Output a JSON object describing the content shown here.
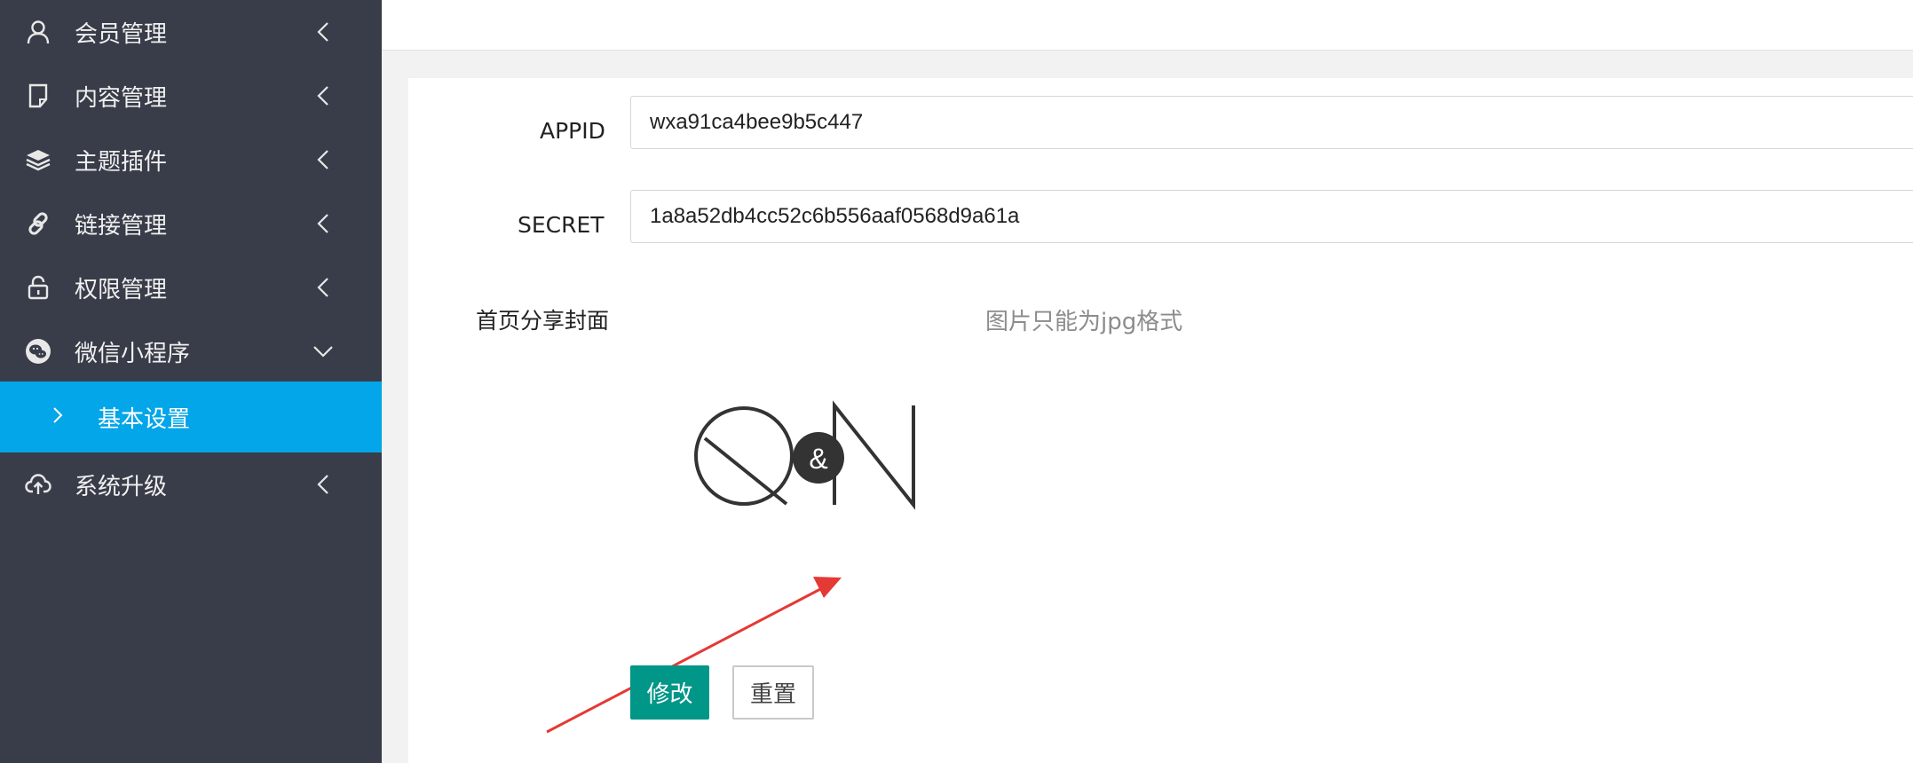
{
  "sidebar": {
    "items": [
      {
        "label": "会员管理",
        "icon": "user-icon"
      },
      {
        "label": "内容管理",
        "icon": "document-icon"
      },
      {
        "label": "主题插件",
        "icon": "layers-icon"
      },
      {
        "label": "链接管理",
        "icon": "link-icon"
      },
      {
        "label": "权限管理",
        "icon": "unlock-icon"
      },
      {
        "label": "微信小程序",
        "icon": "wechat-icon",
        "expanded": true
      },
      {
        "label": "系统升级",
        "icon": "cloud-upload-icon"
      }
    ],
    "sub_item": {
      "label": "基本设置",
      "active": true
    },
    "colors": {
      "background": "#393d49",
      "active": "#03a6e8"
    }
  },
  "form": {
    "appid": {
      "label": "APPID",
      "value": "wxa91ca4bee9b5c447"
    },
    "secret": {
      "label": "SECRET",
      "value": "1a8a52db4cc52c6b556aaf0568d9a61a"
    },
    "cover": {
      "label": "首页分享封面",
      "hint": "图片只能为jpg格式"
    },
    "logo_letters": {
      "left": "Q",
      "middle": "&",
      "right": "N"
    },
    "buttons": {
      "submit": "修改",
      "reset": "重置"
    },
    "colors": {
      "primary": "#009688",
      "annotation_arrow": "#e53935"
    }
  }
}
